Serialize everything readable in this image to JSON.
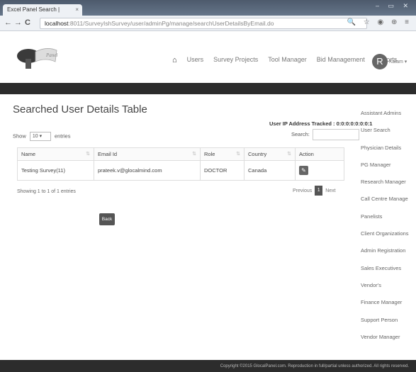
{
  "browser": {
    "tab_title": "Excel Panel Search | ",
    "tab_close": "×",
    "url_host": "localhost",
    "url_path": ":8011/SurveyIshSurvey/user/adminPg/manage/searchUserDetailsByEmail.do",
    "nav_back": "←",
    "nav_forward": "→",
    "reload": "C",
    "toolbar_icons": "🔍 ☆ ◉ ⊕ ≡",
    "window_controls": "‒ ▭ ✕"
  },
  "header": {
    "logo_text": "Panel",
    "nav": [
      "Users",
      "Survey Projects",
      "Tool Manager",
      "Bid Management",
      "Reports"
    ],
    "home_icon": "home-icon",
    "avatar_letter": "R",
    "user_label": "Kalam ▾"
  },
  "main": {
    "title": "Searched User Details Table",
    "ip_label": "User IP Address Tracked : 0:0:0:0:0:0:0:1",
    "show_label": "Show",
    "show_value": "10",
    "entries_label": "entries",
    "search_label": "Search:",
    "table": {
      "columns": [
        "Name",
        "Email Id",
        "Role",
        "Country",
        "Action"
      ],
      "rows": [
        [
          "Testing Survey(11)",
          "prateek.v@glocalmind.com",
          "DOCTOR",
          "Canada"
        ]
      ]
    },
    "info": "Showing 1 to 1 of 1 entries",
    "pager": {
      "previous": "Previous",
      "current": "1",
      "next": "Next"
    },
    "back_label": "Back"
  },
  "sidebar": {
    "items": [
      "Assistant Admins",
      "User Search",
      "Physician Details",
      "PG Manager",
      "Research Manager",
      "Call Centre Manage",
      "Panelists",
      "Client Organizations",
      "Admin Registration",
      "Sales Executives",
      "Vendor's",
      "Finance Manager",
      "Support Person",
      "Vendor Manager"
    ]
  },
  "footer": {
    "text": "Copyright ©2015 GlocalPanel.com. Reproduction in full/partial unless authorized. All rights reserved."
  }
}
